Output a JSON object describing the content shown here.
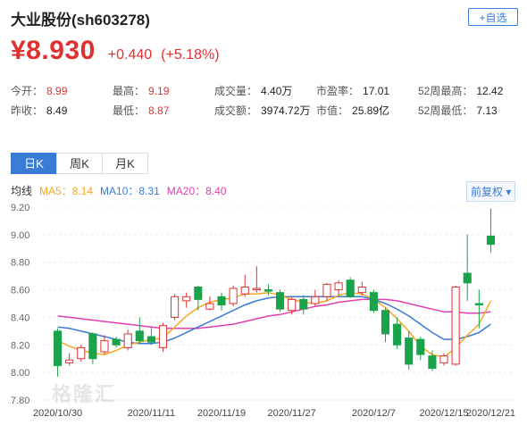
{
  "header": {
    "title": "大业股份(sh603278)",
    "add_label": "+自选"
  },
  "quote": {
    "price": "¥8.930",
    "change": "+0.440",
    "change_pct": "(+5.18%)"
  },
  "stats": {
    "row1": [
      {
        "label": "今开：",
        "value": "8.99",
        "color": "red"
      },
      {
        "label": "最高：",
        "value": "9.19",
        "color": "red"
      },
      {
        "label": "成交量：",
        "value": "4.40万",
        "color": "black"
      },
      {
        "label": "市盈率：",
        "value": "17.01",
        "color": "black"
      },
      {
        "label": "52周最高：",
        "value": "12.42",
        "color": "black"
      }
    ],
    "row2": [
      {
        "label": "昨收：",
        "value": "8.49",
        "color": "black"
      },
      {
        "label": "最低：",
        "value": "8.87",
        "color": "red"
      },
      {
        "label": "成交额：",
        "value": "3974.72万",
        "color": "black"
      },
      {
        "label": "市值：",
        "value": "25.89亿",
        "color": "black"
      },
      {
        "label": "52周最低：",
        "value": "7.13",
        "color": "black"
      }
    ]
  },
  "tabs": [
    {
      "label": "日K",
      "active": true
    },
    {
      "label": "周K",
      "active": false
    },
    {
      "label": "月K",
      "active": false
    }
  ],
  "legend": {
    "title": "均线",
    "ma5": "MA5：8.14",
    "ma10": "MA10：8.31",
    "ma20": "MA20：8.40",
    "ma5_color": "#f5a623",
    "ma10_color": "#3a7bd5",
    "ma20_color": "#e040b0",
    "adjust_label": "前复权 ▾"
  },
  "watermark": "格隆汇",
  "chart_data": {
    "type": "candlestick",
    "ylim": [
      7.8,
      9.2
    ],
    "yticks": [
      "9.20",
      "9.00",
      "8.80",
      "8.60",
      "8.40",
      "8.20",
      "8.00",
      "7.80"
    ],
    "xtick_labels": [
      "2020/10/30",
      "2020/11/11",
      "2020/11/19",
      "2020/11/27",
      "2020/12/7",
      "2020/12/15",
      "2020/12/21"
    ],
    "xtick_index": [
      0,
      8,
      14,
      20,
      27,
      33,
      37
    ],
    "up_color": "#e03131",
    "down_color": "#1aa34a",
    "candles": [
      {
        "o": 8.3,
        "c": 8.05,
        "h": 8.32,
        "l": 7.97
      },
      {
        "o": 8.07,
        "c": 8.09,
        "h": 8.14,
        "l": 8.05
      },
      {
        "o": 8.1,
        "c": 8.18,
        "h": 8.2,
        "l": 8.08
      },
      {
        "o": 8.28,
        "c": 8.1,
        "h": 8.29,
        "l": 8.06
      },
      {
        "o": 8.15,
        "c": 8.23,
        "h": 8.27,
        "l": 8.13
      },
      {
        "o": 8.24,
        "c": 8.2,
        "h": 8.26,
        "l": 8.18
      },
      {
        "o": 8.18,
        "c": 8.28,
        "h": 8.31,
        "l": 8.16
      },
      {
        "o": 8.3,
        "c": 8.23,
        "h": 8.4,
        "l": 8.21
      },
      {
        "o": 8.26,
        "c": 8.22,
        "h": 8.33,
        "l": 8.2
      },
      {
        "o": 8.18,
        "c": 8.34,
        "h": 8.36,
        "l": 8.15
      },
      {
        "o": 8.4,
        "c": 8.55,
        "h": 8.57,
        "l": 8.38
      },
      {
        "o": 8.52,
        "c": 8.55,
        "h": 8.58,
        "l": 8.47
      },
      {
        "o": 8.62,
        "c": 8.53,
        "h": 8.63,
        "l": 8.45
      },
      {
        "o": 8.46,
        "c": 8.5,
        "h": 8.55,
        "l": 8.45
      },
      {
        "o": 8.55,
        "c": 8.49,
        "h": 8.58,
        "l": 8.45
      },
      {
        "o": 8.5,
        "c": 8.61,
        "h": 8.63,
        "l": 8.48
      },
      {
        "o": 8.57,
        "c": 8.62,
        "h": 8.71,
        "l": 8.55
      },
      {
        "o": 8.6,
        "c": 8.61,
        "h": 8.77,
        "l": 8.58
      },
      {
        "o": 8.6,
        "c": 8.59,
        "h": 8.64,
        "l": 8.56
      },
      {
        "o": 8.58,
        "c": 8.46,
        "h": 8.6,
        "l": 8.44
      },
      {
        "o": 8.45,
        "c": 8.53,
        "h": 8.55,
        "l": 8.42
      },
      {
        "o": 8.53,
        "c": 8.46,
        "h": 8.56,
        "l": 8.42
      },
      {
        "o": 8.5,
        "c": 8.55,
        "h": 8.6,
        "l": 8.48
      },
      {
        "o": 8.55,
        "c": 8.64,
        "h": 8.65,
        "l": 8.52
      },
      {
        "o": 8.6,
        "c": 8.65,
        "h": 8.67,
        "l": 8.56
      },
      {
        "o": 8.67,
        "c": 8.55,
        "h": 8.69,
        "l": 8.54
      },
      {
        "o": 8.58,
        "c": 8.62,
        "h": 8.66,
        "l": 8.56
      },
      {
        "o": 8.58,
        "c": 8.45,
        "h": 8.6,
        "l": 8.43
      },
      {
        "o": 8.45,
        "c": 8.28,
        "h": 8.47,
        "l": 8.22
      },
      {
        "o": 8.35,
        "c": 8.2,
        "h": 8.4,
        "l": 8.17
      },
      {
        "o": 8.25,
        "c": 8.06,
        "h": 8.3,
        "l": 8.02
      },
      {
        "o": 8.24,
        "c": 8.13,
        "h": 8.26,
        "l": 8.09
      },
      {
        "o": 8.12,
        "c": 8.03,
        "h": 8.16,
        "l": 8.01
      },
      {
        "o": 8.07,
        "c": 8.12,
        "h": 8.14,
        "l": 8.05
      },
      {
        "o": 8.06,
        "c": 8.62,
        "h": 8.63,
        "l": 8.05
      },
      {
        "o": 8.72,
        "c": 8.65,
        "h": 9.0,
        "l": 8.52
      },
      {
        "o": 8.5,
        "c": 8.49,
        "h": 8.6,
        "l": 8.32
      },
      {
        "o": 8.99,
        "c": 8.93,
        "h": 9.19,
        "l": 8.87
      }
    ],
    "ma5": [
      8.23,
      8.19,
      8.16,
      8.14,
      8.13,
      8.16,
      8.2,
      8.22,
      8.24,
      8.25,
      8.33,
      8.41,
      8.47,
      8.51,
      8.53,
      8.54,
      8.57,
      8.57,
      8.58,
      8.56,
      8.53,
      8.51,
      8.5,
      8.52,
      8.56,
      8.58,
      8.57,
      8.53,
      8.47,
      8.39,
      8.3,
      8.19,
      8.13,
      8.11,
      8.18,
      8.27,
      8.35,
      8.52
    ],
    "ma10": [
      8.33,
      8.32,
      8.3,
      8.28,
      8.26,
      8.24,
      8.22,
      8.21,
      8.21,
      8.22,
      8.25,
      8.29,
      8.33,
      8.37,
      8.41,
      8.45,
      8.49,
      8.52,
      8.54,
      8.55,
      8.55,
      8.55,
      8.55,
      8.55,
      8.55,
      8.55,
      8.55,
      8.53,
      8.5,
      8.46,
      8.41,
      8.35,
      8.29,
      8.24,
      8.24,
      8.26,
      8.29,
      8.35
    ],
    "ma20": [
      8.41,
      8.4,
      8.39,
      8.38,
      8.37,
      8.36,
      8.35,
      8.34,
      8.33,
      8.32,
      8.32,
      8.32,
      8.32,
      8.33,
      8.34,
      8.35,
      8.37,
      8.39,
      8.41,
      8.42,
      8.44,
      8.46,
      8.48,
      8.49,
      8.51,
      8.52,
      8.53,
      8.53,
      8.53,
      8.52,
      8.5,
      8.48,
      8.46,
      8.44,
      8.44,
      8.43,
      8.43,
      8.44
    ]
  }
}
